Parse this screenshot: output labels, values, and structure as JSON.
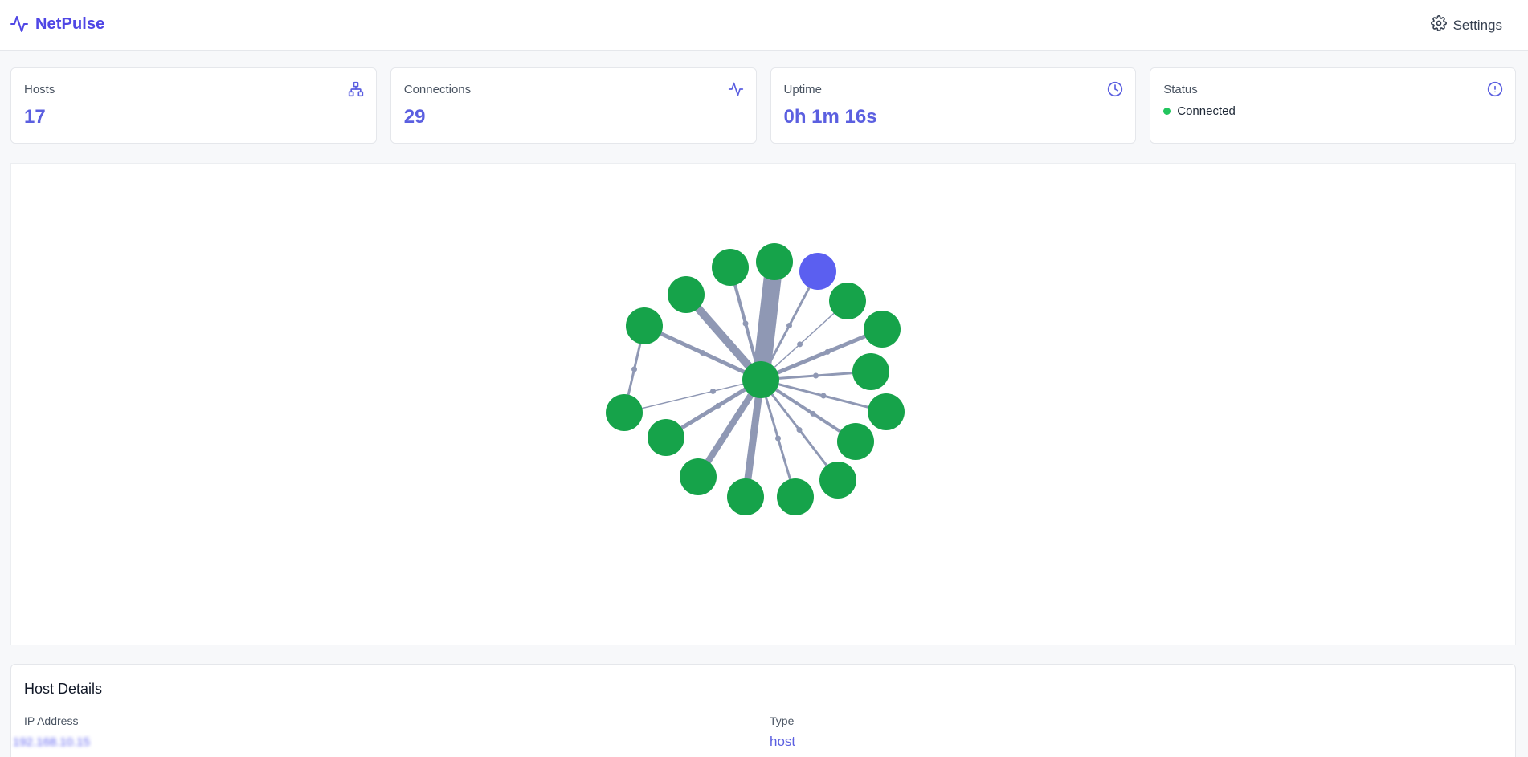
{
  "app": {
    "name": "NetPulse",
    "brand_color": "#4f46e5",
    "logo_icon": "activity-pulse-icon"
  },
  "header": {
    "settings_label": "Settings",
    "settings_icon": "gear-icon"
  },
  "stats": [
    {
      "title": "Hosts",
      "value": "17",
      "icon": "network-tree-icon"
    },
    {
      "title": "Connections",
      "value": "29",
      "icon": "activity-pulse-icon"
    },
    {
      "title": "Uptime",
      "value": "0h 1m 16s",
      "icon": "clock-icon"
    },
    {
      "title": "Status",
      "value": "Connected",
      "icon": "alert-circle-icon",
      "indicator_color": "#22c55e"
    }
  ],
  "graph": {
    "node_color": "#16a34a",
    "selected_node_color": "#5b5ff0",
    "edge_color": "#8f98b4",
    "node_count": 17,
    "selected_node": 16
  },
  "details": {
    "title": "Host Details",
    "ip_label": "IP Address",
    "ip_value": "192.168.10.15",
    "type_label": "Type",
    "type_value": "host"
  }
}
